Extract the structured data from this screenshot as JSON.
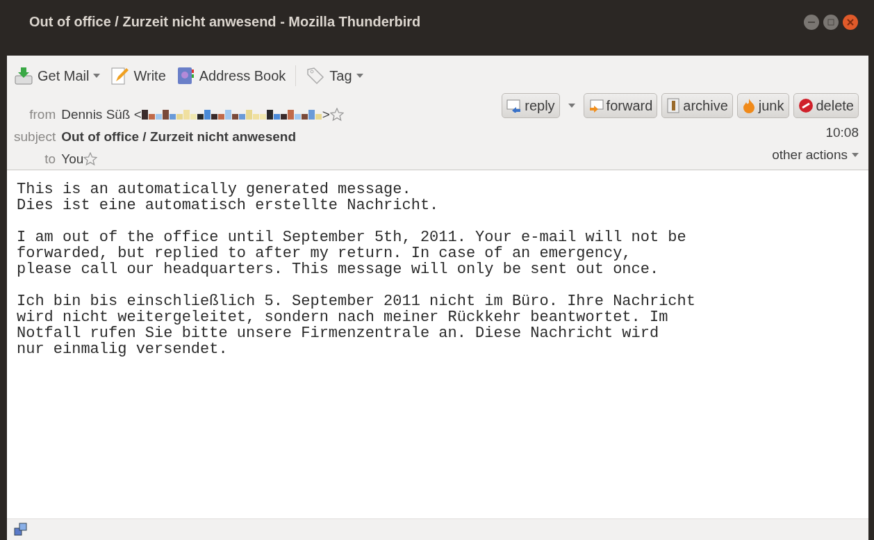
{
  "window": {
    "title": "Out of office / Zurzeit nicht anwesend - Mozilla Thunderbird"
  },
  "toolbar": [
    {
      "label": "Get Mail",
      "kind": "getmail",
      "dropdown": true
    },
    {
      "label": "Write",
      "kind": "write",
      "dropdown": false
    },
    {
      "label": "Address Book",
      "kind": "addressbook",
      "dropdown": false
    },
    {
      "label": "Tag",
      "kind": "tag",
      "dropdown": true
    }
  ],
  "header": {
    "from_label": "from",
    "from_name": "Dennis Süß <",
    "from_end": ">",
    "subject_label": "subject",
    "subject": "Out of office / Zurzeit nicht anwesend",
    "to_label": "to",
    "to": "You",
    "time": "10:08",
    "other_actions": "other actions"
  },
  "actions": [
    {
      "label": "reply",
      "kind": "reply",
      "dropdown": true
    },
    {
      "label": "forward",
      "kind": "forward",
      "dropdown": false
    },
    {
      "label": "archive",
      "kind": "archive",
      "dropdown": false
    },
    {
      "label": "junk",
      "kind": "junk",
      "dropdown": false
    },
    {
      "label": "delete",
      "kind": "delete",
      "dropdown": false
    }
  ],
  "body": [
    "This is an automatically generated message.\nDies ist eine automatisch erstellte Nachricht.",
    "I am out of the office until September 5th, 2011. Your e-mail will not be\nforwarded, but replied to after my return. In case of an emergency,\nplease call our headquarters. This message will only be sent out once.",
    "Ich bin bis einschließlich 5. September 2011 nicht im Büro. Ihre Nachricht\nwird nicht weitergeleitet, sondern nach meiner Rückkehr beantwortet. Im\nNotfall rufen Sie bitte unsere Firmenzentrale an. Diese Nachricht wird\nnur einmalig versendet."
  ]
}
